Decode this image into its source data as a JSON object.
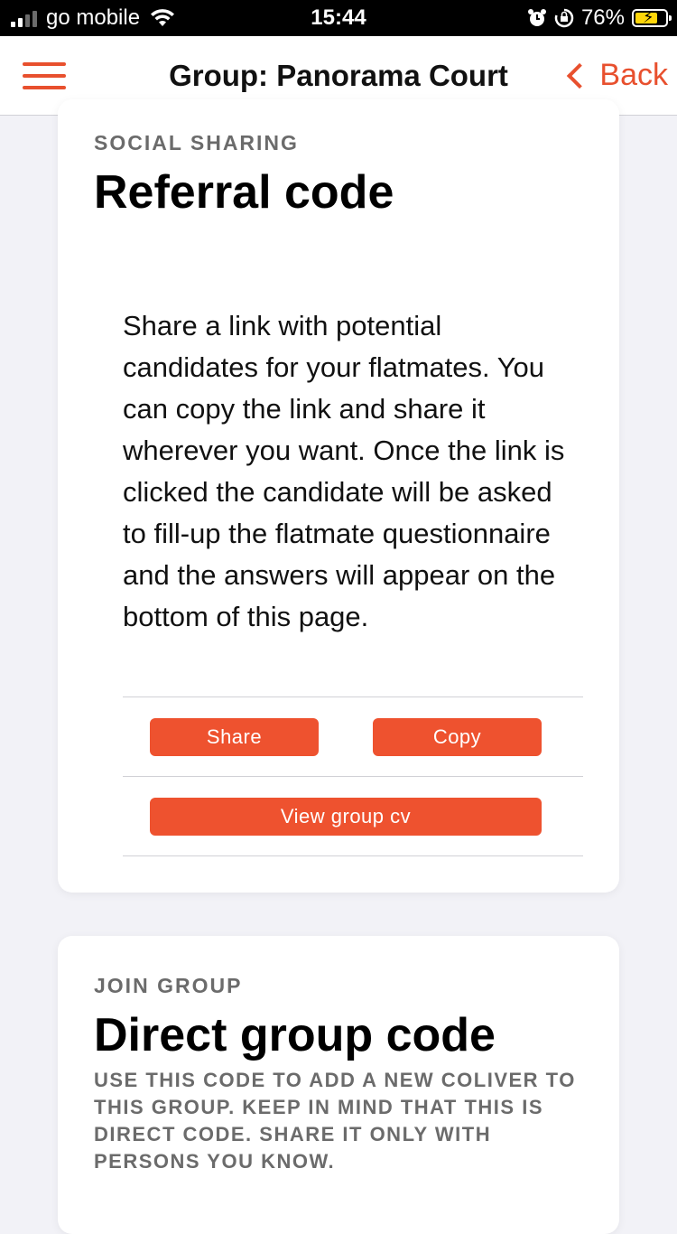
{
  "status_bar": {
    "carrier": "go mobile",
    "time": "15:44",
    "battery_percent": "76%",
    "signal_bars": 4,
    "signal_bars_active": 2,
    "battery_level": 0.76,
    "battery_color": "#ffd60a",
    "icons": [
      "signal-icon",
      "wifi-icon",
      "alarm-icon",
      "orientation-lock-icon",
      "battery-icon"
    ]
  },
  "navbar": {
    "title": "Group: Panorama Court",
    "back_label": "Back",
    "accent_color": "#e8502e",
    "menu_icon": "hamburger-menu-icon",
    "back_icon": "chevron-left-icon"
  },
  "referral_card": {
    "eyebrow": "SOCIAL SHARING",
    "title": "Referral code",
    "description": "Share a link with potential candidates for your flatmates. You can copy the link and share it wherever you want. Once the link is clicked the candidate will be asked to fill-up the flatmate questionnaire and the answers will appear on the bottom of this page.",
    "share_label": "Share",
    "copy_label": "Copy",
    "view_cv_label": "View group cv",
    "button_color": "#ee522f"
  },
  "join_card": {
    "eyebrow": "JOIN GROUP",
    "title": "Direct group code",
    "note": "USE THIS CODE TO ADD A NEW COLIVER TO THIS GROUP. KEEP IN MIND THAT THIS IS DIRECT CODE. SHARE IT ONLY WITH PERSONS YOU KNOW."
  }
}
